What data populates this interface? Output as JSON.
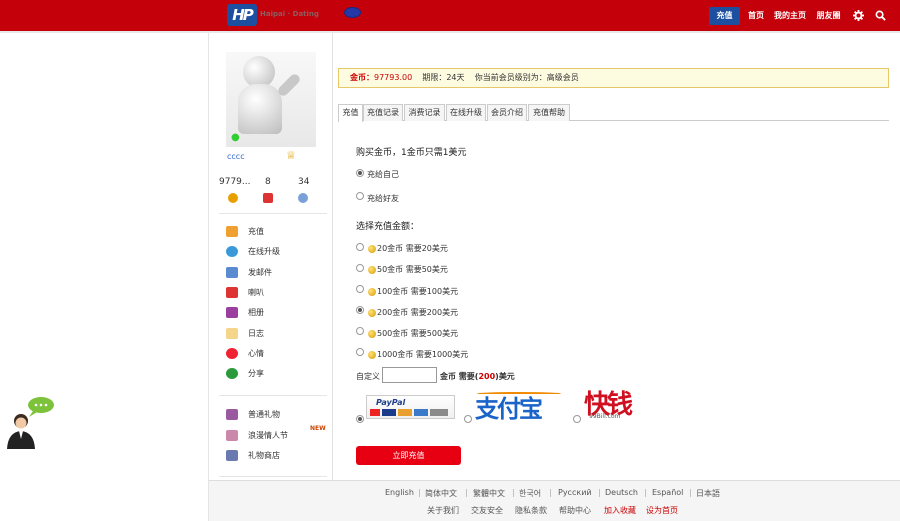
{
  "header": {
    "logo_text": "Haipai · Dating",
    "nav": {
      "recharge": "充值",
      "home": "首页",
      "my_home": "我的主页",
      "friends": "朋友圈"
    },
    "icons": [
      "gear-icon",
      "search-icon"
    ]
  },
  "profile": {
    "username": "cccc",
    "stats": [
      "9779...",
      "8",
      "34"
    ]
  },
  "sidebar": {
    "menu1": [
      "充值",
      "在线升级",
      "发邮件",
      "喇叭",
      "相册",
      "日志",
      "心情",
      "分享"
    ],
    "menu2": [
      "普通礼物",
      "浪漫情人节",
      "礼物商店"
    ],
    "new_badge": "NEW"
  },
  "goldbar": {
    "gold_label": "金币：",
    "gold_value": "97793.00",
    "expiry": "期限：24天",
    "level": "你当前会员级别为：高级会员"
  },
  "tabs": [
    "充值",
    "充值记录",
    "消费记录",
    "在线升级",
    "会员介绍",
    "充值帮助"
  ],
  "form": {
    "title": "购买金币，1金币只需1美元",
    "targets": [
      "充给自己",
      "充给好友"
    ],
    "amount_title": "选择充值金额：",
    "amounts": [
      "20金币 需要20美元",
      "50金币 需要50美元",
      "100金币 需要100美元",
      "200金币 需要200美元",
      "500金币 需要500美元",
      "1000金币 需要1000美元"
    ],
    "custom_label": "自定义",
    "custom_suffix1": "金币  需要(",
    "custom_amount": "200",
    "custom_suffix2": ")美元",
    "payment": {
      "paypal": "PayPal",
      "alipay": "支付宝",
      "bill99": "快钱",
      "bill99_sub": "99Bill.com"
    },
    "submit": "立即充值"
  },
  "footer": {
    "languages": [
      "English",
      "简体中文",
      "繁體中文",
      "한국어",
      "Русский",
      "Deutsch",
      "Español",
      "日本語"
    ],
    "links": [
      "关于我们",
      "交友安全",
      "隐私条款",
      "帮助中心",
      "加入收藏",
      "设为首页"
    ]
  },
  "colors": {
    "brand_red": "#c4000b",
    "blue": "#1d4fa0",
    "gold_text": "#cc0000"
  }
}
